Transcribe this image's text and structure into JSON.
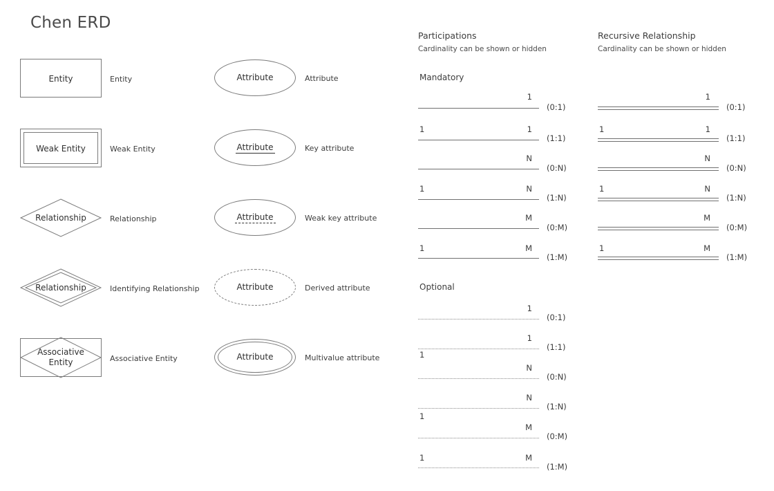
{
  "title": "Chen ERD",
  "symbols": {
    "entities": [
      {
        "shape": "rectangle",
        "shape_text": "Entity",
        "label": "Entity"
      },
      {
        "shape": "double-rectangle",
        "shape_text": "Weak Entity",
        "label": "Weak Entity"
      },
      {
        "shape": "diamond",
        "shape_text": "Relationship",
        "label": "Relationship"
      },
      {
        "shape": "double-diamond",
        "shape_text": "Relationship",
        "label": "Identifying Relationship"
      },
      {
        "shape": "rect-diamond",
        "shape_text": "Associative\nEntity",
        "label": "Associative Entity"
      }
    ],
    "attributes": [
      {
        "shape": "ellipse",
        "shape_text": "Attribute",
        "underline": "none",
        "label": "Attribute"
      },
      {
        "shape": "ellipse",
        "shape_text": "Attribute",
        "underline": "solid",
        "label": "Key attribute"
      },
      {
        "shape": "ellipse",
        "shape_text": "Attribute",
        "underline": "dashed",
        "label": "Weak key attribute"
      },
      {
        "shape": "dashed-ellipse",
        "shape_text": "Attribute",
        "underline": "none",
        "label": "Derived attribute"
      },
      {
        "shape": "double-ellipse",
        "shape_text": "Attribute",
        "underline": "none",
        "label": "Multivalue attribute"
      }
    ]
  },
  "participations": {
    "title": "Participations",
    "subtitle": "Cardinality can be shown or hidden",
    "groups": [
      {
        "name": "Mandatory",
        "line_style": "solid",
        "rows": [
          {
            "left": "",
            "right": "1",
            "note": "(0:1)",
            "left_below": false
          },
          {
            "left": "1",
            "right": "1",
            "note": "(1:1)",
            "left_below": false
          },
          {
            "left": "",
            "right": "N",
            "note": "(0:N)",
            "left_below": false
          },
          {
            "left": "1",
            "right": "N",
            "note": "(1:N)",
            "left_below": false
          },
          {
            "left": "",
            "right": "M",
            "note": "(0:M)",
            "left_below": false
          },
          {
            "left": "1",
            "right": "M",
            "note": "(1:M)",
            "left_below": false
          }
        ]
      },
      {
        "name": "Optional",
        "line_style": "dotted",
        "rows": [
          {
            "left": "",
            "right": "1",
            "note": "(0:1)",
            "left_below": false
          },
          {
            "left": "1",
            "right": "1",
            "note": "(1:1)",
            "left_below": true
          },
          {
            "left": "",
            "right": "N",
            "note": "(0:N)",
            "left_below": false
          },
          {
            "left": "1",
            "right": "N",
            "note": "(1:N)",
            "left_below": true
          },
          {
            "left": "",
            "right": "M",
            "note": "(0:M)",
            "left_below": false
          },
          {
            "left": "1",
            "right": "M",
            "note": "(1:M)",
            "left_below": false
          }
        ]
      }
    ]
  },
  "recursive": {
    "title": "Recursive Relationship",
    "subtitle": "Cardinality can be shown or hidden",
    "line_style": "double",
    "rows": [
      {
        "left": "",
        "right": "1",
        "note": "(0:1)"
      },
      {
        "left": "1",
        "right": "1",
        "note": "(1:1)"
      },
      {
        "left": "",
        "right": "N",
        "note": "(0:N)"
      },
      {
        "left": "1",
        "right": "N",
        "note": "(1:N)"
      },
      {
        "left": "",
        "right": "M",
        "note": "(0:M)"
      },
      {
        "left": "1",
        "right": "M",
        "note": "(1:M)"
      }
    ]
  },
  "colors": {
    "stroke": "#7a7a7a",
    "text": "#3b3b3b",
    "title": "#4a4a4a"
  }
}
